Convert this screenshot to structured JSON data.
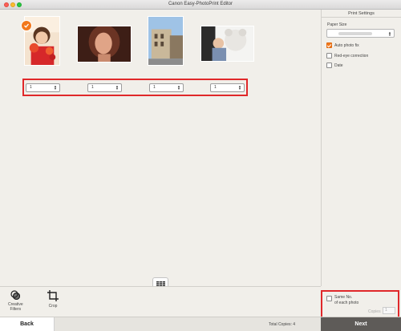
{
  "window": {
    "title": "Canon Easy-PhotoPrint Editor"
  },
  "photos": [
    {
      "name": "girl-with-flowers"
    },
    {
      "name": "woman-portrait"
    },
    {
      "name": "building"
    },
    {
      "name": "child-with-teddy-bear"
    }
  ],
  "copies": [
    {
      "value": "1"
    },
    {
      "value": "1"
    },
    {
      "value": "1"
    },
    {
      "value": "1"
    }
  ],
  "settings": {
    "header": "Print Settings",
    "paper_size_label": "Paper Size",
    "auto_photo_fix": {
      "label": "Auto photo fix",
      "checked": true
    },
    "red_eye": {
      "label": "Red-eye correction",
      "checked": false
    },
    "date": {
      "label": "Date",
      "checked": false
    },
    "same_no_line1": "Same No.",
    "same_no_line2": "of each photo",
    "copies_label": "Copies",
    "copies_value": "1"
  },
  "tools": {
    "creative_filters_line1": "Creative",
    "creative_filters_line2": "Filters",
    "crop": "Crop"
  },
  "footer": {
    "back": "Back",
    "total_copies": "Total Copies: 4",
    "next": "Next"
  },
  "colors": {
    "accent": "#f2781c",
    "highlight": "#e0282a",
    "next_bg": "#5e5b58"
  }
}
